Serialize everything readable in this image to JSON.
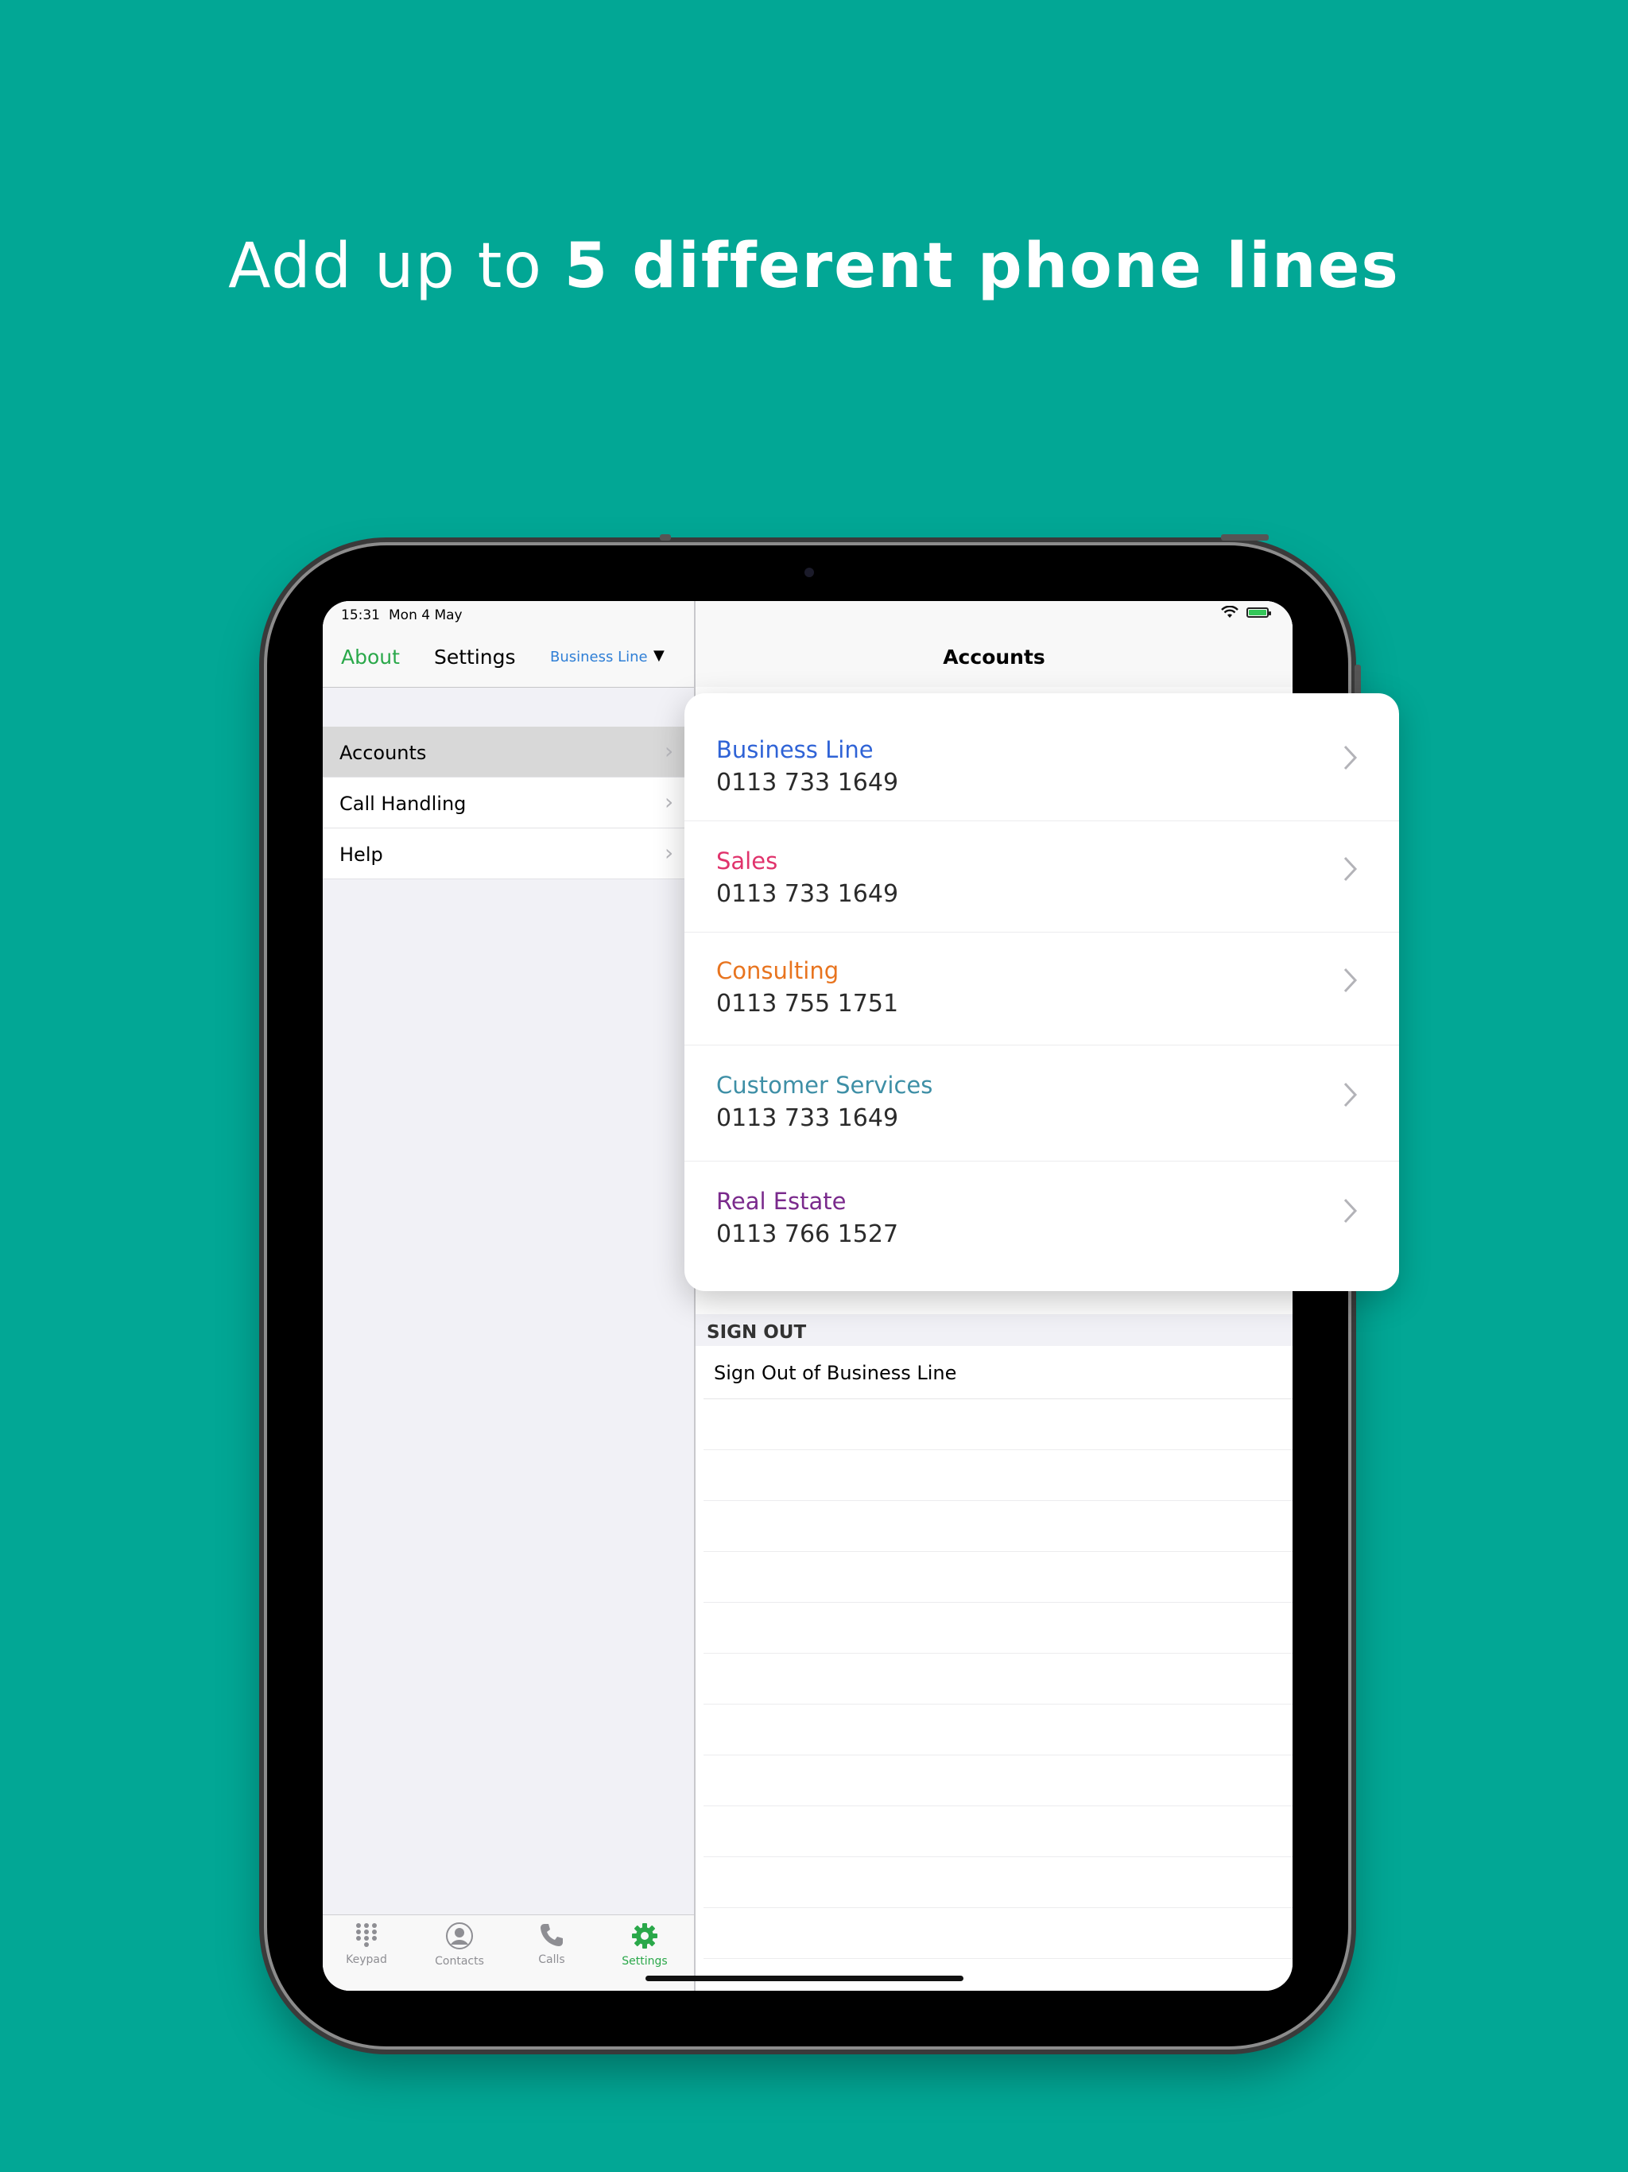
{
  "headline": {
    "prefix": "Add up to ",
    "emphasis": "5 different phone lines"
  },
  "status_bar": {
    "time": "15:31",
    "date": "Mon 4 May"
  },
  "sidebar_nav": {
    "about": "About",
    "title": "Settings",
    "line": "Business Line",
    "caret": "▼"
  },
  "menu": [
    {
      "label": "Accounts",
      "selected": true
    },
    {
      "label": "Call Handling",
      "selected": false
    },
    {
      "label": "Help",
      "selected": false
    }
  ],
  "tabs": [
    {
      "label": "Keypad",
      "icon": "keypad-icon",
      "active": false
    },
    {
      "label": "Contacts",
      "icon": "contacts-icon",
      "active": false
    },
    {
      "label": "Calls",
      "icon": "phone-icon",
      "active": false
    },
    {
      "label": "Settings",
      "icon": "gear-icon",
      "active": true
    }
  ],
  "detail": {
    "title": "Accounts",
    "section": "SIGN OUT",
    "signout_label": "Sign Out of Business Line"
  },
  "accounts": [
    {
      "name": "Business Line",
      "number": "0113 733 1649",
      "color": "#2f63d6"
    },
    {
      "name": "Sales",
      "number": "0113 733 1649",
      "color": "#e0336c"
    },
    {
      "name": "Consulting",
      "number": "0113 755 1751",
      "color": "#e8741f"
    },
    {
      "name": "Customer Services",
      "number": "0113 733 1649",
      "color": "#3e8fa6"
    },
    {
      "name": "Real Estate",
      "number": "0113 766 1527",
      "color": "#7a2a8c"
    }
  ],
  "colors": {
    "background": "#02a795",
    "accent_green": "#2aa84a",
    "link_blue": "#2f7fd6"
  }
}
